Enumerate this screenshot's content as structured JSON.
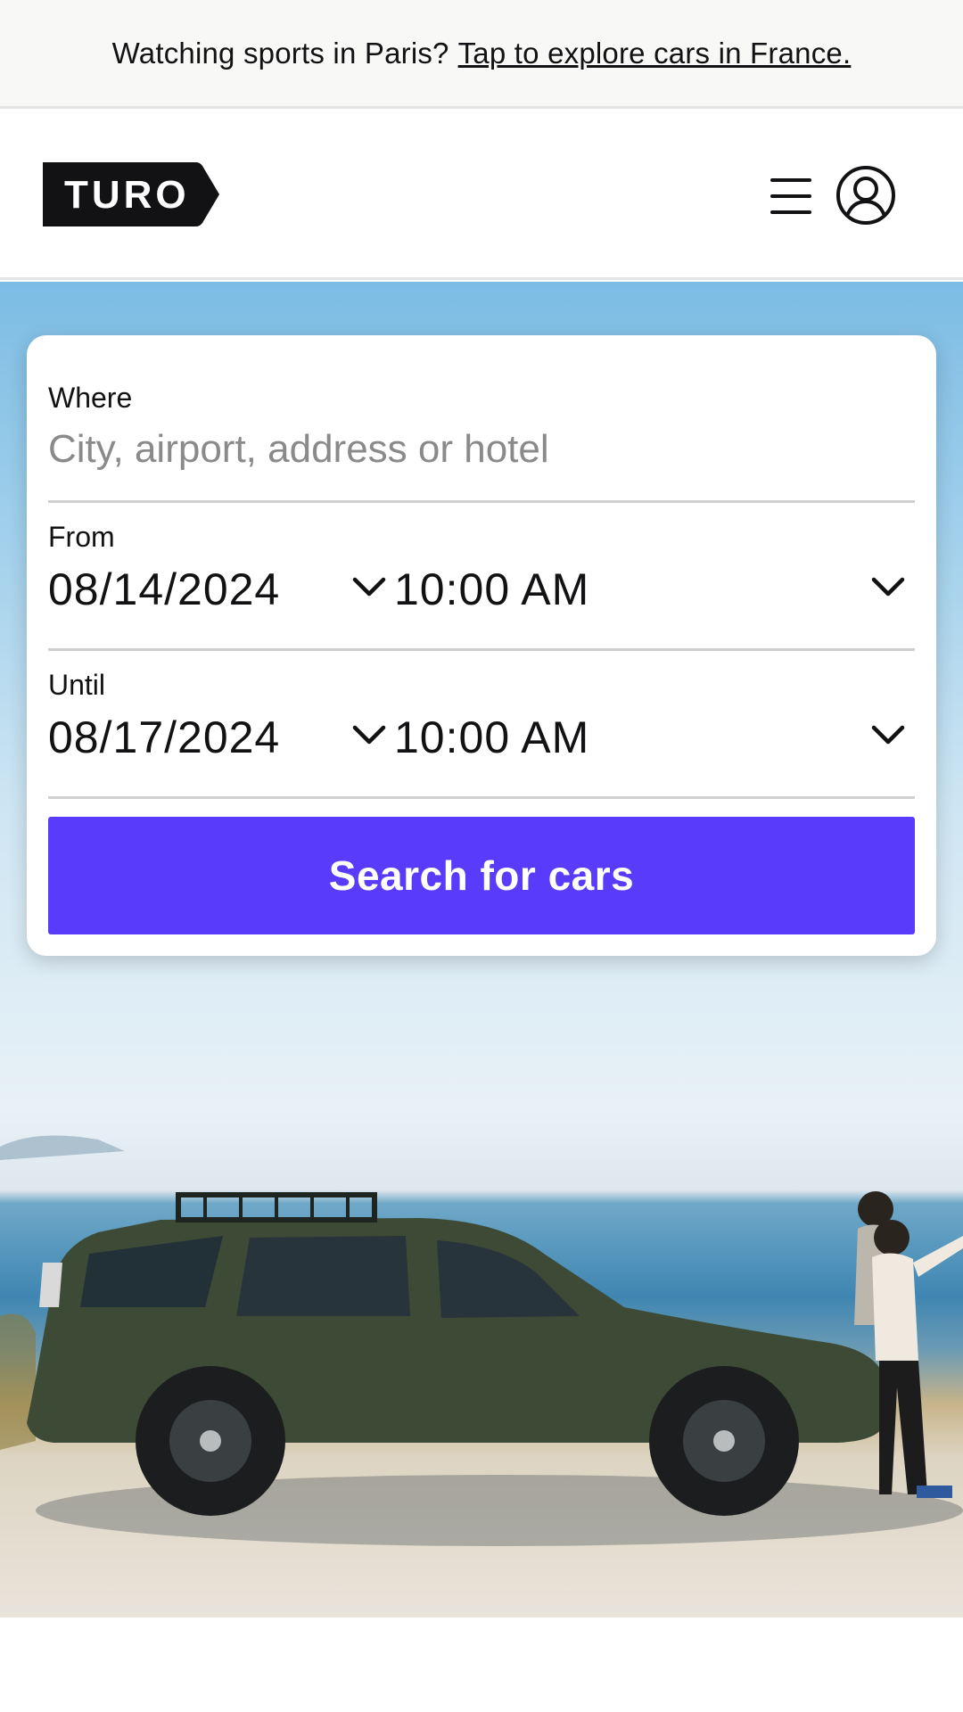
{
  "promo": {
    "text": "Watching sports in Paris?",
    "link": "Tap to explore cars in France."
  },
  "header": {
    "logo_text": "TURO",
    "menu_icon": "hamburger-menu-icon",
    "profile_icon": "user-profile-icon"
  },
  "search": {
    "where_label": "Where",
    "where_placeholder": "City, airport, address or hotel",
    "from_label": "From",
    "from_date": "08/14/2024",
    "from_time": "10:00 AM",
    "until_label": "Until",
    "until_date": "08/17/2024",
    "until_time": "10:00 AM",
    "button_label": "Search for cars"
  },
  "colors": {
    "accent": "#593cfb",
    "text": "#121214",
    "promo_bg": "#f8f8f6"
  }
}
